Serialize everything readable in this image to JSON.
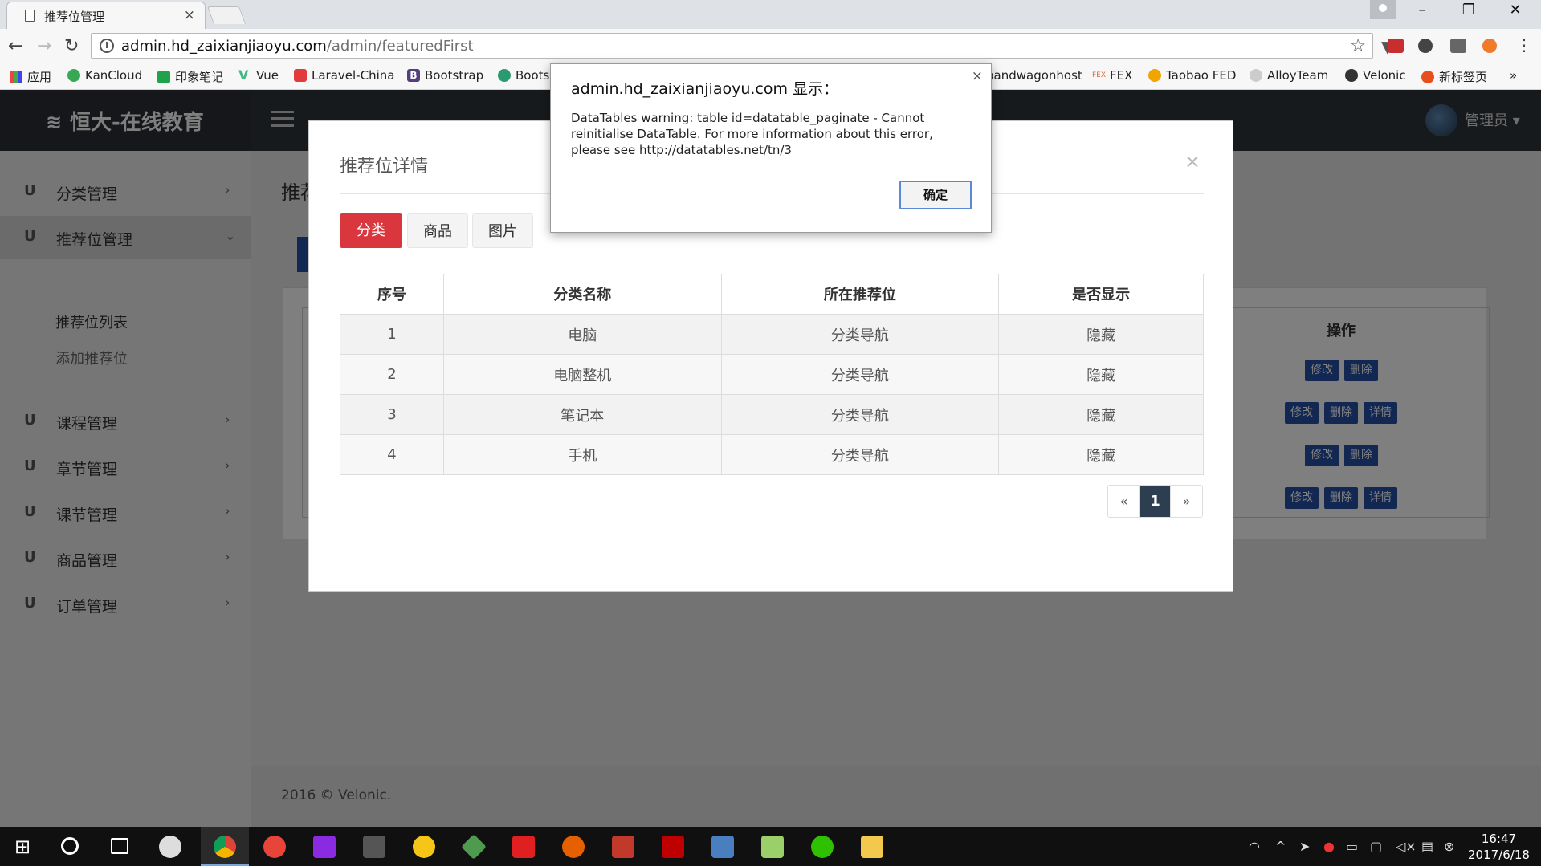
{
  "browser": {
    "tab_title": "推荐位管理",
    "tab_close": "×",
    "url_host": "admin.hd_zaixianjiaoyu.com",
    "url_path": "/admin/featuredFirst",
    "bookmarks": [
      "应用",
      "KanCloud",
      "印象笔记",
      "Vue",
      "Laravel-China",
      "Bootstrap",
      "Boots",
      "bandwagonhost",
      "FEX",
      "Taobao FED",
      "AlloyTeam",
      "Velonic",
      "新标签页"
    ],
    "bookmark_colors": [
      "#2b7de9",
      "#3aa757",
      "#1fa24a",
      "#41b883",
      "#e23b3b",
      "#563d7c",
      "#2b9a6f",
      "#444",
      "#e06c3b",
      "#f2a400",
      "#999",
      "#333",
      "#e84e1b"
    ],
    "overflow": "»"
  },
  "app": {
    "brand": "恒大-在线教育",
    "admin": "管理员",
    "footer": "2016 © Velonic.",
    "bg_title": "推荐",
    "bg_th": "操作",
    "row_buttons": [
      [
        "修改",
        "删除"
      ],
      [
        "修改",
        "删除",
        "详情"
      ],
      [
        "修改",
        "删除"
      ],
      [
        "修改",
        "删除",
        "详情"
      ]
    ]
  },
  "sidebar": {
    "items": [
      {
        "icon": "U",
        "label": "分类管理",
        "active": false
      },
      {
        "icon": "U",
        "label": "推荐位管理",
        "active": true
      },
      {
        "icon": "U",
        "label": "课程管理",
        "active": false
      },
      {
        "icon": "U",
        "label": "章节管理",
        "active": false
      },
      {
        "icon": "U",
        "label": "课节管理",
        "active": false
      },
      {
        "icon": "U",
        "label": "商品管理",
        "active": false
      },
      {
        "icon": "U",
        "label": "订单管理",
        "active": false
      }
    ],
    "subitems": [
      "推荐位列表",
      "添加推荐位"
    ]
  },
  "modal": {
    "title": "推荐位详情",
    "close": "×",
    "tabs": [
      {
        "label": "分类",
        "active": true
      },
      {
        "label": "商品",
        "active": false
      },
      {
        "label": "图片",
        "active": false
      }
    ],
    "columns": [
      "序号",
      "分类名称",
      "所在推荐位",
      "是否显示"
    ],
    "rows": [
      [
        "1",
        "电脑",
        "分类导航",
        "隐藏"
      ],
      [
        "2",
        "电脑整机",
        "分类导航",
        "隐藏"
      ],
      [
        "3",
        "笔记本",
        "分类导航",
        "隐藏"
      ],
      [
        "4",
        "手机",
        "分类导航",
        "隐藏"
      ]
    ],
    "pager": {
      "prev": "«",
      "current": "1",
      "next": "»"
    }
  },
  "alert": {
    "title": "admin.hd_zaixianjiaoyu.com 显示：",
    "message": "DataTables warning: table id=datatable_paginate - Cannot reinitialise DataTable. For more information about this error, please see http://datatables.net/tn/3",
    "ok": "确定",
    "close": "×"
  },
  "taskbar": {
    "time": "16:47",
    "date": "2017/6/18"
  },
  "colors": {
    "accent_red": "#d9363e",
    "accent_blue": "#2451a6",
    "pager_active": "#2c3e50",
    "header_dark": "#2f343a"
  }
}
